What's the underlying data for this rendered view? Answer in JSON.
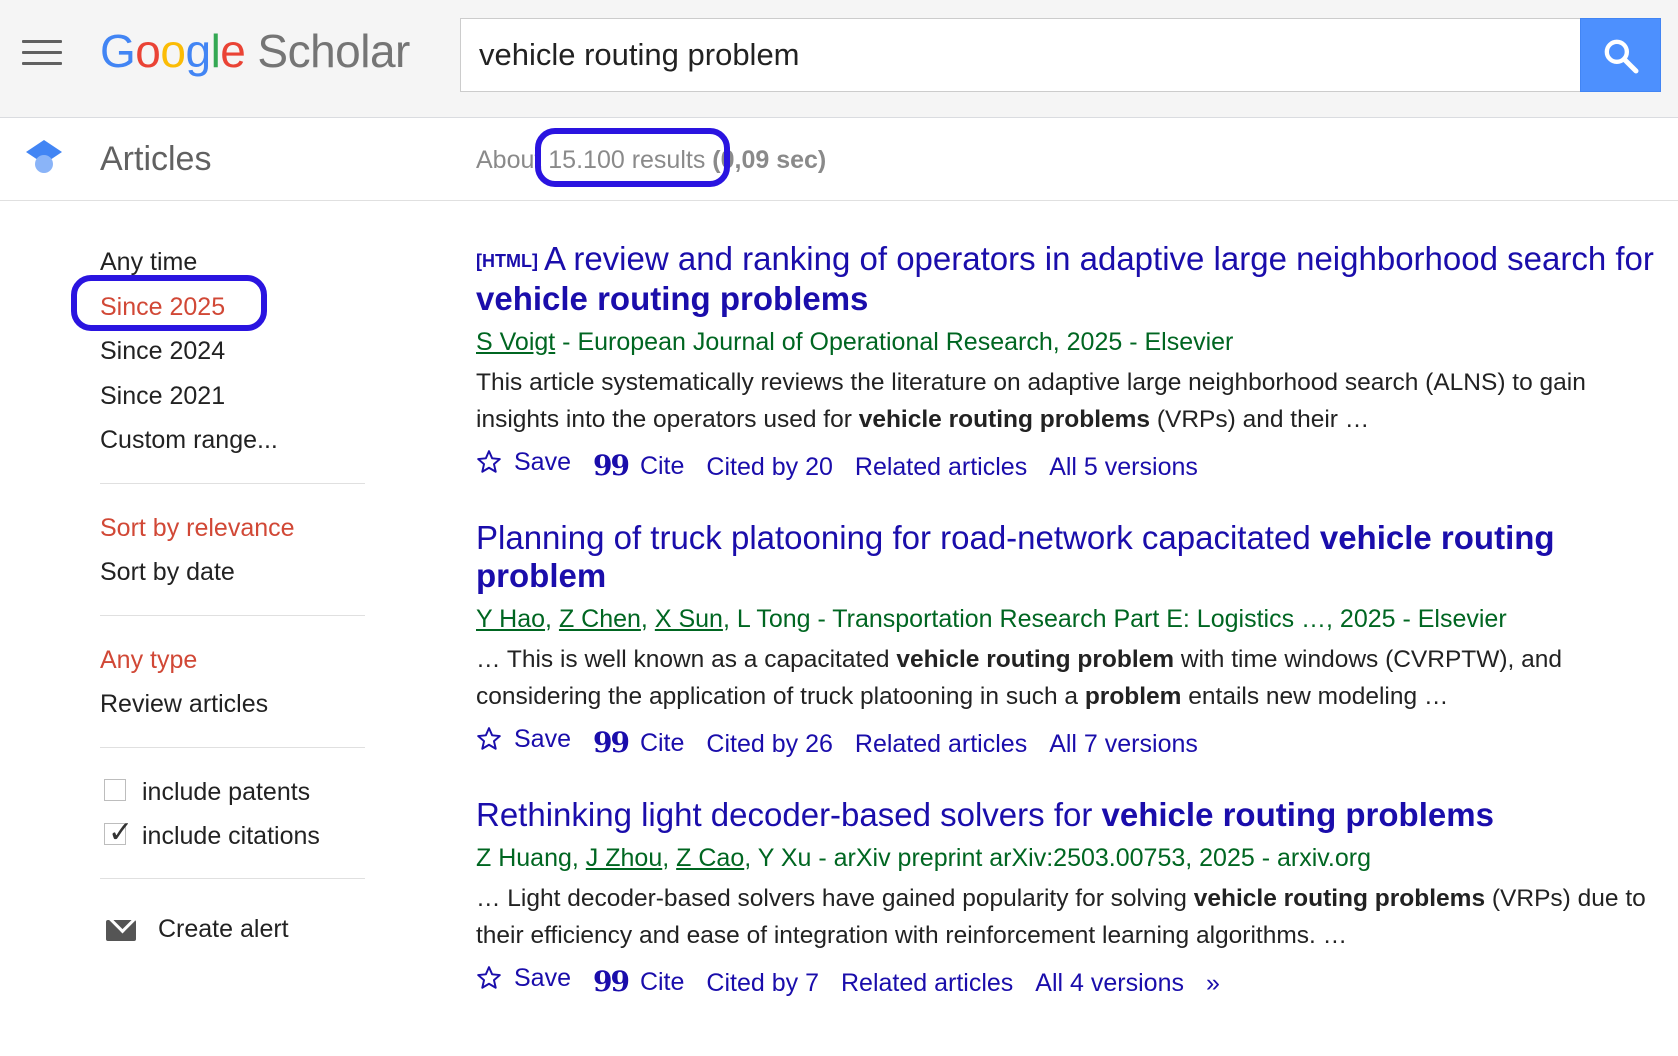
{
  "header": {
    "logo_google": [
      "G",
      "o",
      "o",
      "g",
      "l",
      "e"
    ],
    "logo_scholar": "Scholar",
    "search_value": "vehicle routing problem"
  },
  "subheader": {
    "section_label": "Articles",
    "stats_prefix": "About ",
    "stats_count": "15.100 results",
    "stats_time": " (0,09 sec)"
  },
  "sidebar": {
    "time_filters": [
      "Any time",
      "Since 2025",
      "Since 2024",
      "Since 2021",
      "Custom range..."
    ],
    "sort_options": [
      "Sort by relevance",
      "Sort by date"
    ],
    "type_options": [
      "Any type",
      "Review articles"
    ],
    "checkboxes": [
      {
        "label": "include patents",
        "checked": false
      },
      {
        "label": "include citations",
        "checked": true
      }
    ],
    "create_alert": "Create alert"
  },
  "results": [
    {
      "tag": "[HTML]",
      "title_parts": [
        {
          "text": "A review and ranking of operators in adaptive large neighborhood search for ",
          "bold": false
        },
        {
          "text": "vehicle routing problems",
          "bold": true
        }
      ],
      "authors": [
        {
          "name": "S Voigt",
          "linked": true
        }
      ],
      "source": " - European Journal of Operational Research, 2025 - Elsevier",
      "snippet_parts": [
        {
          "text": "This article systematically reviews the literature on adaptive large neighborhood search (ALNS) to gain insights into the operators used for ",
          "bold": false
        },
        {
          "text": "vehicle routing problems",
          "bold": true
        },
        {
          "text": " (VRPs) and their …",
          "bold": false
        }
      ],
      "actions": {
        "save": "Save",
        "cite": "Cite",
        "cited_by": "Cited by 20",
        "related": "Related articles",
        "versions": "All 5 versions"
      }
    },
    {
      "tag": "",
      "title_parts": [
        {
          "text": "Planning of truck platooning for road-network capacitated ",
          "bold": false
        },
        {
          "text": "vehicle routing problem",
          "bold": true
        }
      ],
      "authors": [
        {
          "name": "Y Hao",
          "linked": true
        },
        {
          "name": "Z Chen",
          "linked": true
        },
        {
          "name": "X Sun",
          "linked": true
        },
        {
          "name": "L Tong",
          "linked": false
        }
      ],
      "source": " - Transportation Research Part E: Logistics …, 2025 - Elsevier",
      "snippet_parts": [
        {
          "text": "… This is well known as a capacitated ",
          "bold": false
        },
        {
          "text": "vehicle routing problem",
          "bold": true
        },
        {
          "text": " with time windows (CVRPTW), and considering the application of truck platooning in such a ",
          "bold": false
        },
        {
          "text": "problem",
          "bold": true
        },
        {
          "text": " entails new modeling …",
          "bold": false
        }
      ],
      "actions": {
        "save": "Save",
        "cite": "Cite",
        "cited_by": "Cited by 26",
        "related": "Related articles",
        "versions": "All 7 versions"
      }
    },
    {
      "tag": "",
      "title_parts": [
        {
          "text": "Rethinking light decoder-based solvers for ",
          "bold": false
        },
        {
          "text": "vehicle routing problems",
          "bold": true
        }
      ],
      "authors": [
        {
          "name": "Z Huang",
          "linked": false
        },
        {
          "name": "J Zhou",
          "linked": true
        },
        {
          "name": "Z Cao",
          "linked": true
        },
        {
          "name": "Y Xu",
          "linked": false
        }
      ],
      "source": " - arXiv preprint arXiv:2503.00753, 2025 - arxiv.org",
      "snippet_parts": [
        {
          "text": "… Light decoder-based solvers have gained popularity for solving ",
          "bold": false
        },
        {
          "text": "vehicle routing problems",
          "bold": true
        },
        {
          "text": " (VRPs) due to their efficiency and ease of integration with reinforcement learning algorithms. …",
          "bold": false
        }
      ],
      "actions": {
        "save": "Save",
        "cite": "Cite",
        "cited_by": "Cited by 7",
        "related": "Related articles",
        "versions": "All 4 versions",
        "more": true
      }
    }
  ],
  "annotations": {
    "ring_color": "#2a14e0"
  }
}
